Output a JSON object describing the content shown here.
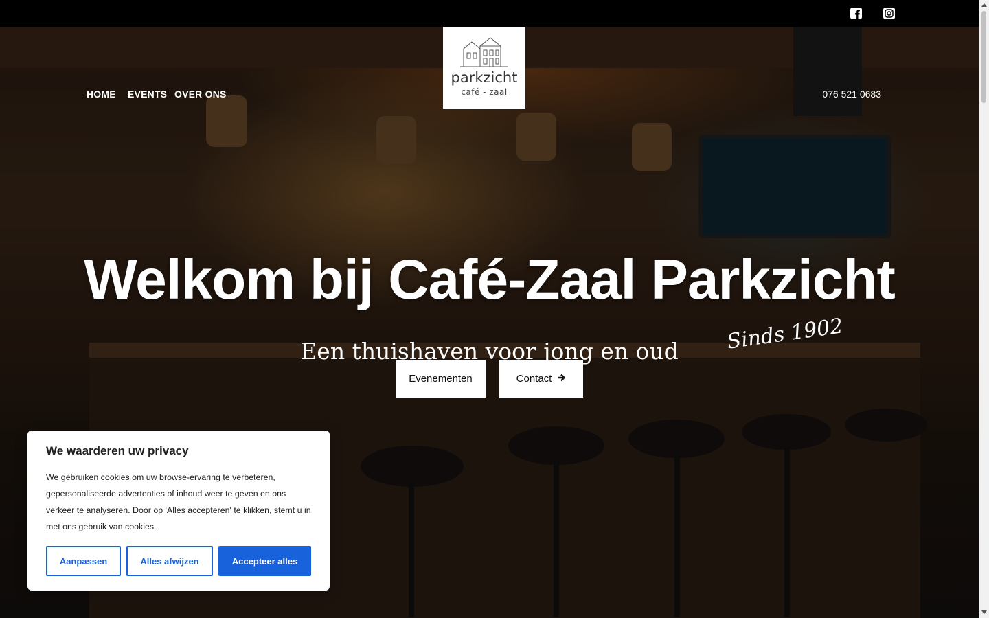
{
  "topbar": {
    "social": [
      "facebook-square-icon",
      "instagram-icon"
    ]
  },
  "nav": {
    "items": [
      "HOME",
      "EVENTS",
      "OVER ONS"
    ],
    "phone": "076 521 0683"
  },
  "logo": {
    "word": "parkzicht",
    "sub": "café - zaal"
  },
  "hero": {
    "title": "Welkom bij Café-Zaal Parkzicht",
    "since": "Sinds 1902",
    "subtitle": "Een thuishaven voor jong en oud",
    "buttons": {
      "events": "Evenementen",
      "contact": "Contact"
    }
  },
  "cookie": {
    "title": "We waarderen uw privacy",
    "body": "We gebruiken cookies om uw browse-ervaring te verbeteren, gepersonaliseerde advertenties of inhoud weer te geven en ons verkeer te analyseren. Door op 'Alles accepteren' te klikken, stemt u in met ons gebruik van cookies.",
    "customize": "Aanpassen",
    "reject": "Alles afwijzen",
    "accept": "Accepteer alles"
  },
  "colors": {
    "accent": "#1863dc",
    "topbar": "#000000"
  }
}
